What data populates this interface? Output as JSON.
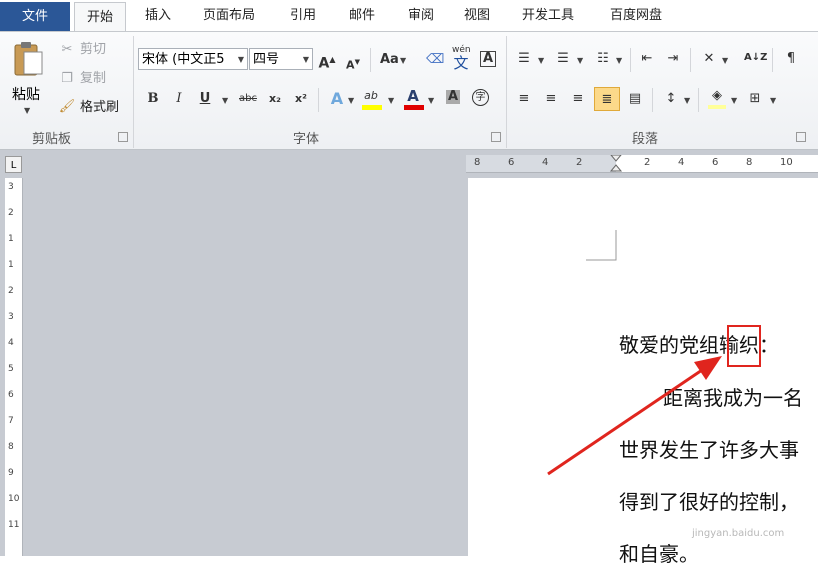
{
  "tabs": [
    "文件",
    "开始",
    "插入",
    "页面布局",
    "引用",
    "邮件",
    "审阅",
    "视图",
    "开发工具",
    "百度网盘"
  ],
  "active_tab": "开始",
  "clipboard": {
    "paste": "粘贴",
    "cut": "剪切",
    "copy": "复制",
    "format_painter": "格式刷",
    "group_label": "剪贴板"
  },
  "font": {
    "font_name": "宋体 (中文正5",
    "font_size": "四号",
    "group_label": "字体",
    "bold": "B",
    "italic": "I",
    "underline": "U",
    "strikethrough": "abc",
    "subscript": "x₂",
    "superscript": "x²",
    "grow": "A",
    "shrink": "A",
    "change_case": "Aa",
    "phonetic": "wén",
    "phonetic_char": "文",
    "char_border": "A",
    "text_effect": "A",
    "highlight": "ab",
    "font_color": "A",
    "char_shading": "A",
    "enclose": "字"
  },
  "paragraph": {
    "group_label": "段落",
    "sort": "A↓Z"
  },
  "ruler_marks": [
    "8",
    "6",
    "4",
    "2",
    "2",
    "4",
    "6",
    "8",
    "10"
  ],
  "vruler_marks": [
    "3",
    "2",
    "1",
    "1",
    "2",
    "3",
    "4",
    "5",
    "6",
    "7",
    "8",
    "9",
    "10",
    "11"
  ],
  "document_lines": [
    "敬爱的党组输织：",
    "距离我成为一名",
    "世界发生了许多大事",
    "得到了很好的控制，",
    "和自豪。"
  ],
  "watermark": "jingyan.baidu.com",
  "colors": {
    "file_tab": "#2b5797",
    "highlight_box": "#e0251e",
    "arrow": "#e0251e",
    "font_color_bar": "#e00000",
    "highlight_bar": "#ffff00"
  }
}
